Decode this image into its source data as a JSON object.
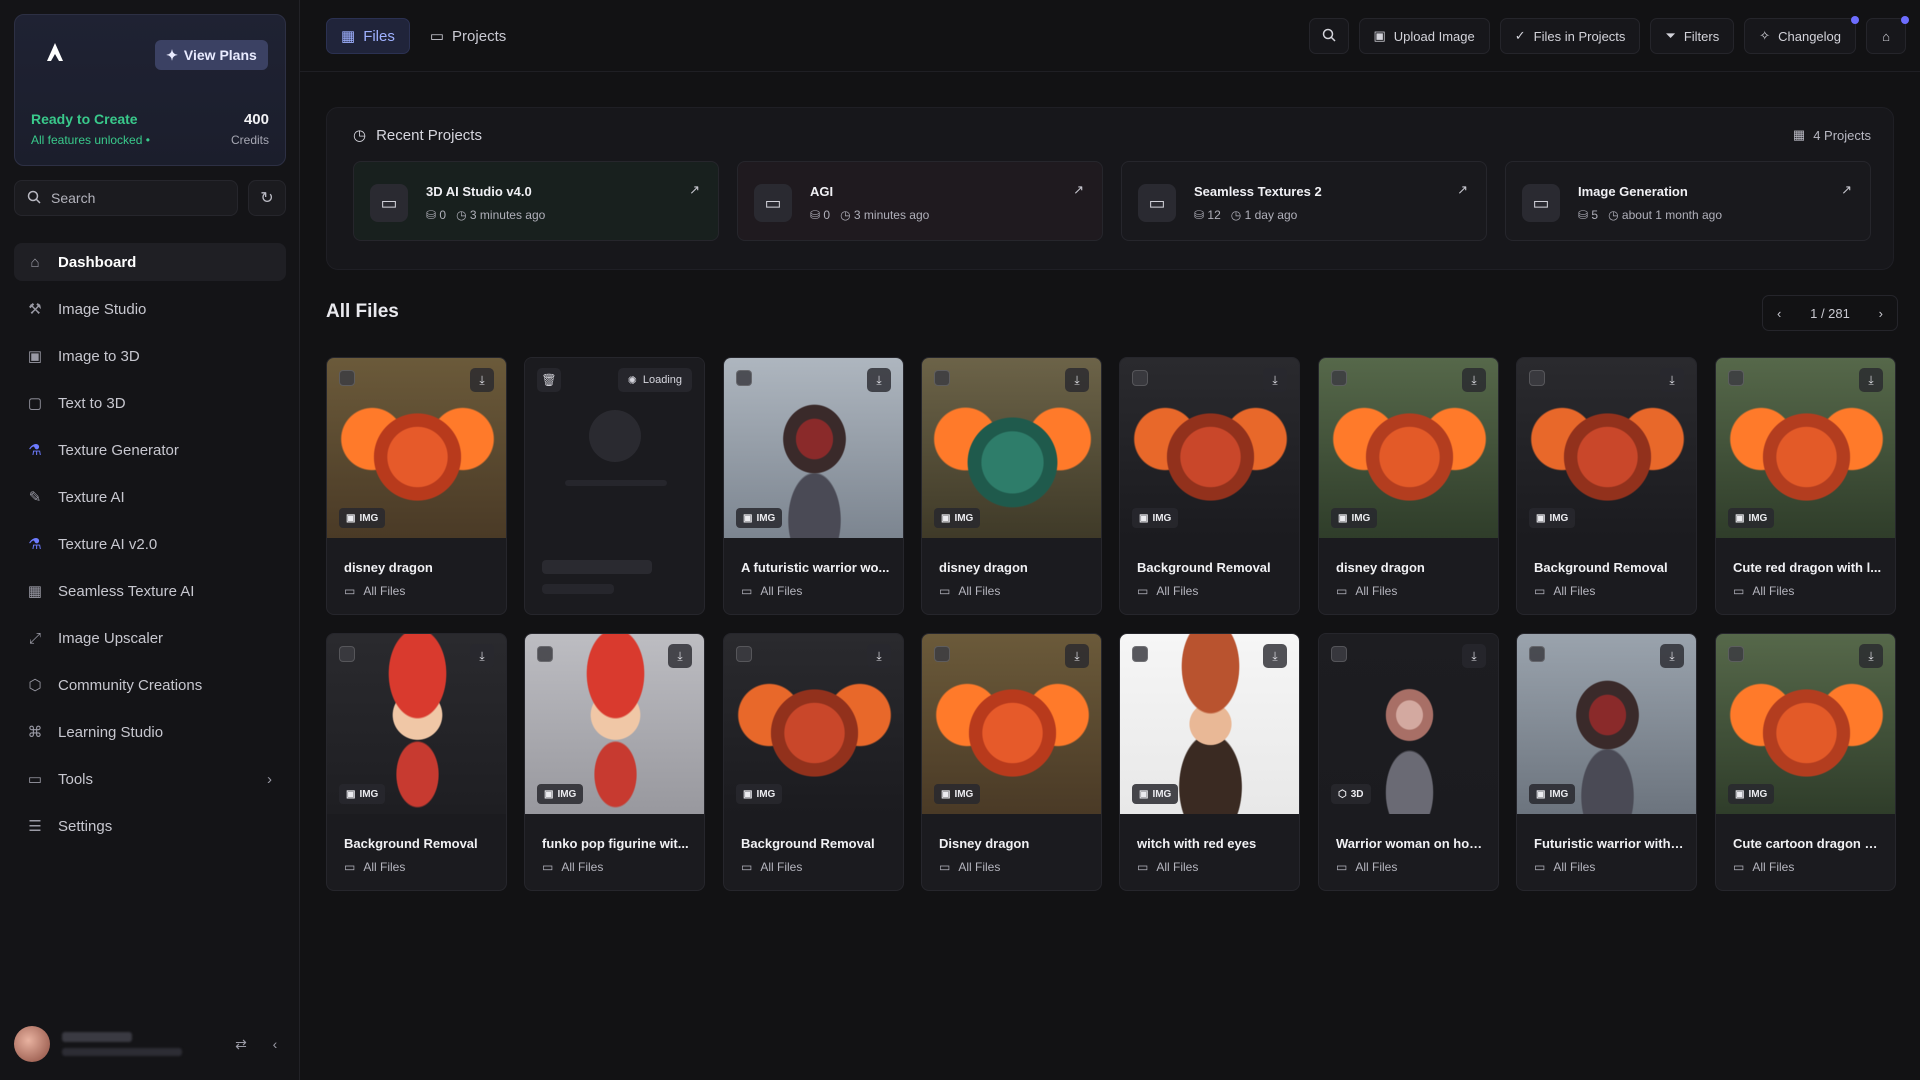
{
  "sidebar": {
    "view_plans": "View Plans",
    "status": "Ready to Create",
    "features": "All features unlocked",
    "credits_value": "400",
    "credits_label": "Credits",
    "search_placeholder": "Search",
    "nav": [
      {
        "label": "Dashboard",
        "icon": "home-icon"
      },
      {
        "label": "Image Studio",
        "icon": "image-studio-icon"
      },
      {
        "label": "Image to 3D",
        "icon": "image-to-3d-icon"
      },
      {
        "label": "Text to 3D",
        "icon": "text-to-3d-icon"
      },
      {
        "label": "Texture Generator",
        "icon": "flask-icon"
      },
      {
        "label": "Texture AI",
        "icon": "brush-icon"
      },
      {
        "label": "Texture AI v2.0",
        "icon": "flask-icon"
      },
      {
        "label": "Seamless Texture AI",
        "icon": "pattern-icon"
      },
      {
        "label": "Image Upscaler",
        "icon": "upscale-icon"
      },
      {
        "label": "Community Creations",
        "icon": "cube-icon"
      },
      {
        "label": "Learning Studio",
        "icon": "graduation-icon"
      },
      {
        "label": "Tools",
        "icon": "folder-icon"
      },
      {
        "label": "Settings",
        "icon": "sliders-icon"
      }
    ]
  },
  "topbar": {
    "tab_files": "Files",
    "tab_projects": "Projects",
    "upload": "Upload Image",
    "files_in_projects": "Files in Projects",
    "filters": "Filters",
    "changelog": "Changelog"
  },
  "recent": {
    "title": "Recent Projects",
    "count": "4 Projects",
    "projects": [
      {
        "name": "3D AI Studio v4.0",
        "items": "0",
        "time": "3 minutes ago"
      },
      {
        "name": "AGI",
        "items": "0",
        "time": "3 minutes ago"
      },
      {
        "name": "Seamless Textures 2",
        "items": "12",
        "time": "1 day ago"
      },
      {
        "name": "Image Generation",
        "items": "5",
        "time": "about 1 month ago"
      }
    ]
  },
  "files": {
    "title": "All Files",
    "pager": "1 / 281",
    "folder_label": "All Files",
    "loading": "Loading",
    "cards": [
      {
        "title": "disney dragon",
        "type": "IMG"
      },
      {
        "title": "",
        "type": ""
      },
      {
        "title": "A futuristic warrior wo...",
        "type": "IMG"
      },
      {
        "title": "disney dragon",
        "type": "IMG"
      },
      {
        "title": "Background Removal",
        "type": "IMG"
      },
      {
        "title": "disney dragon",
        "type": "IMG"
      },
      {
        "title": "Background Removal",
        "type": "IMG"
      },
      {
        "title": "Cute red dragon with l...",
        "type": "IMG"
      },
      {
        "title": "Background Removal",
        "type": "IMG"
      },
      {
        "title": "funko pop figurine wit...",
        "type": "IMG"
      },
      {
        "title": "Background Removal",
        "type": "IMG"
      },
      {
        "title": "Disney dragon",
        "type": "IMG"
      },
      {
        "title": "witch with red eyes",
        "type": "IMG"
      },
      {
        "title": "Warrior woman on hov...",
        "type": "3D"
      },
      {
        "title": "Futuristic warrior with ...",
        "type": "IMG"
      },
      {
        "title": "Cute cartoon dragon w...",
        "type": "IMG"
      }
    ]
  },
  "colors": {
    "accent": "#6d7bff",
    "success": "#39c98b",
    "background": "#121214"
  }
}
